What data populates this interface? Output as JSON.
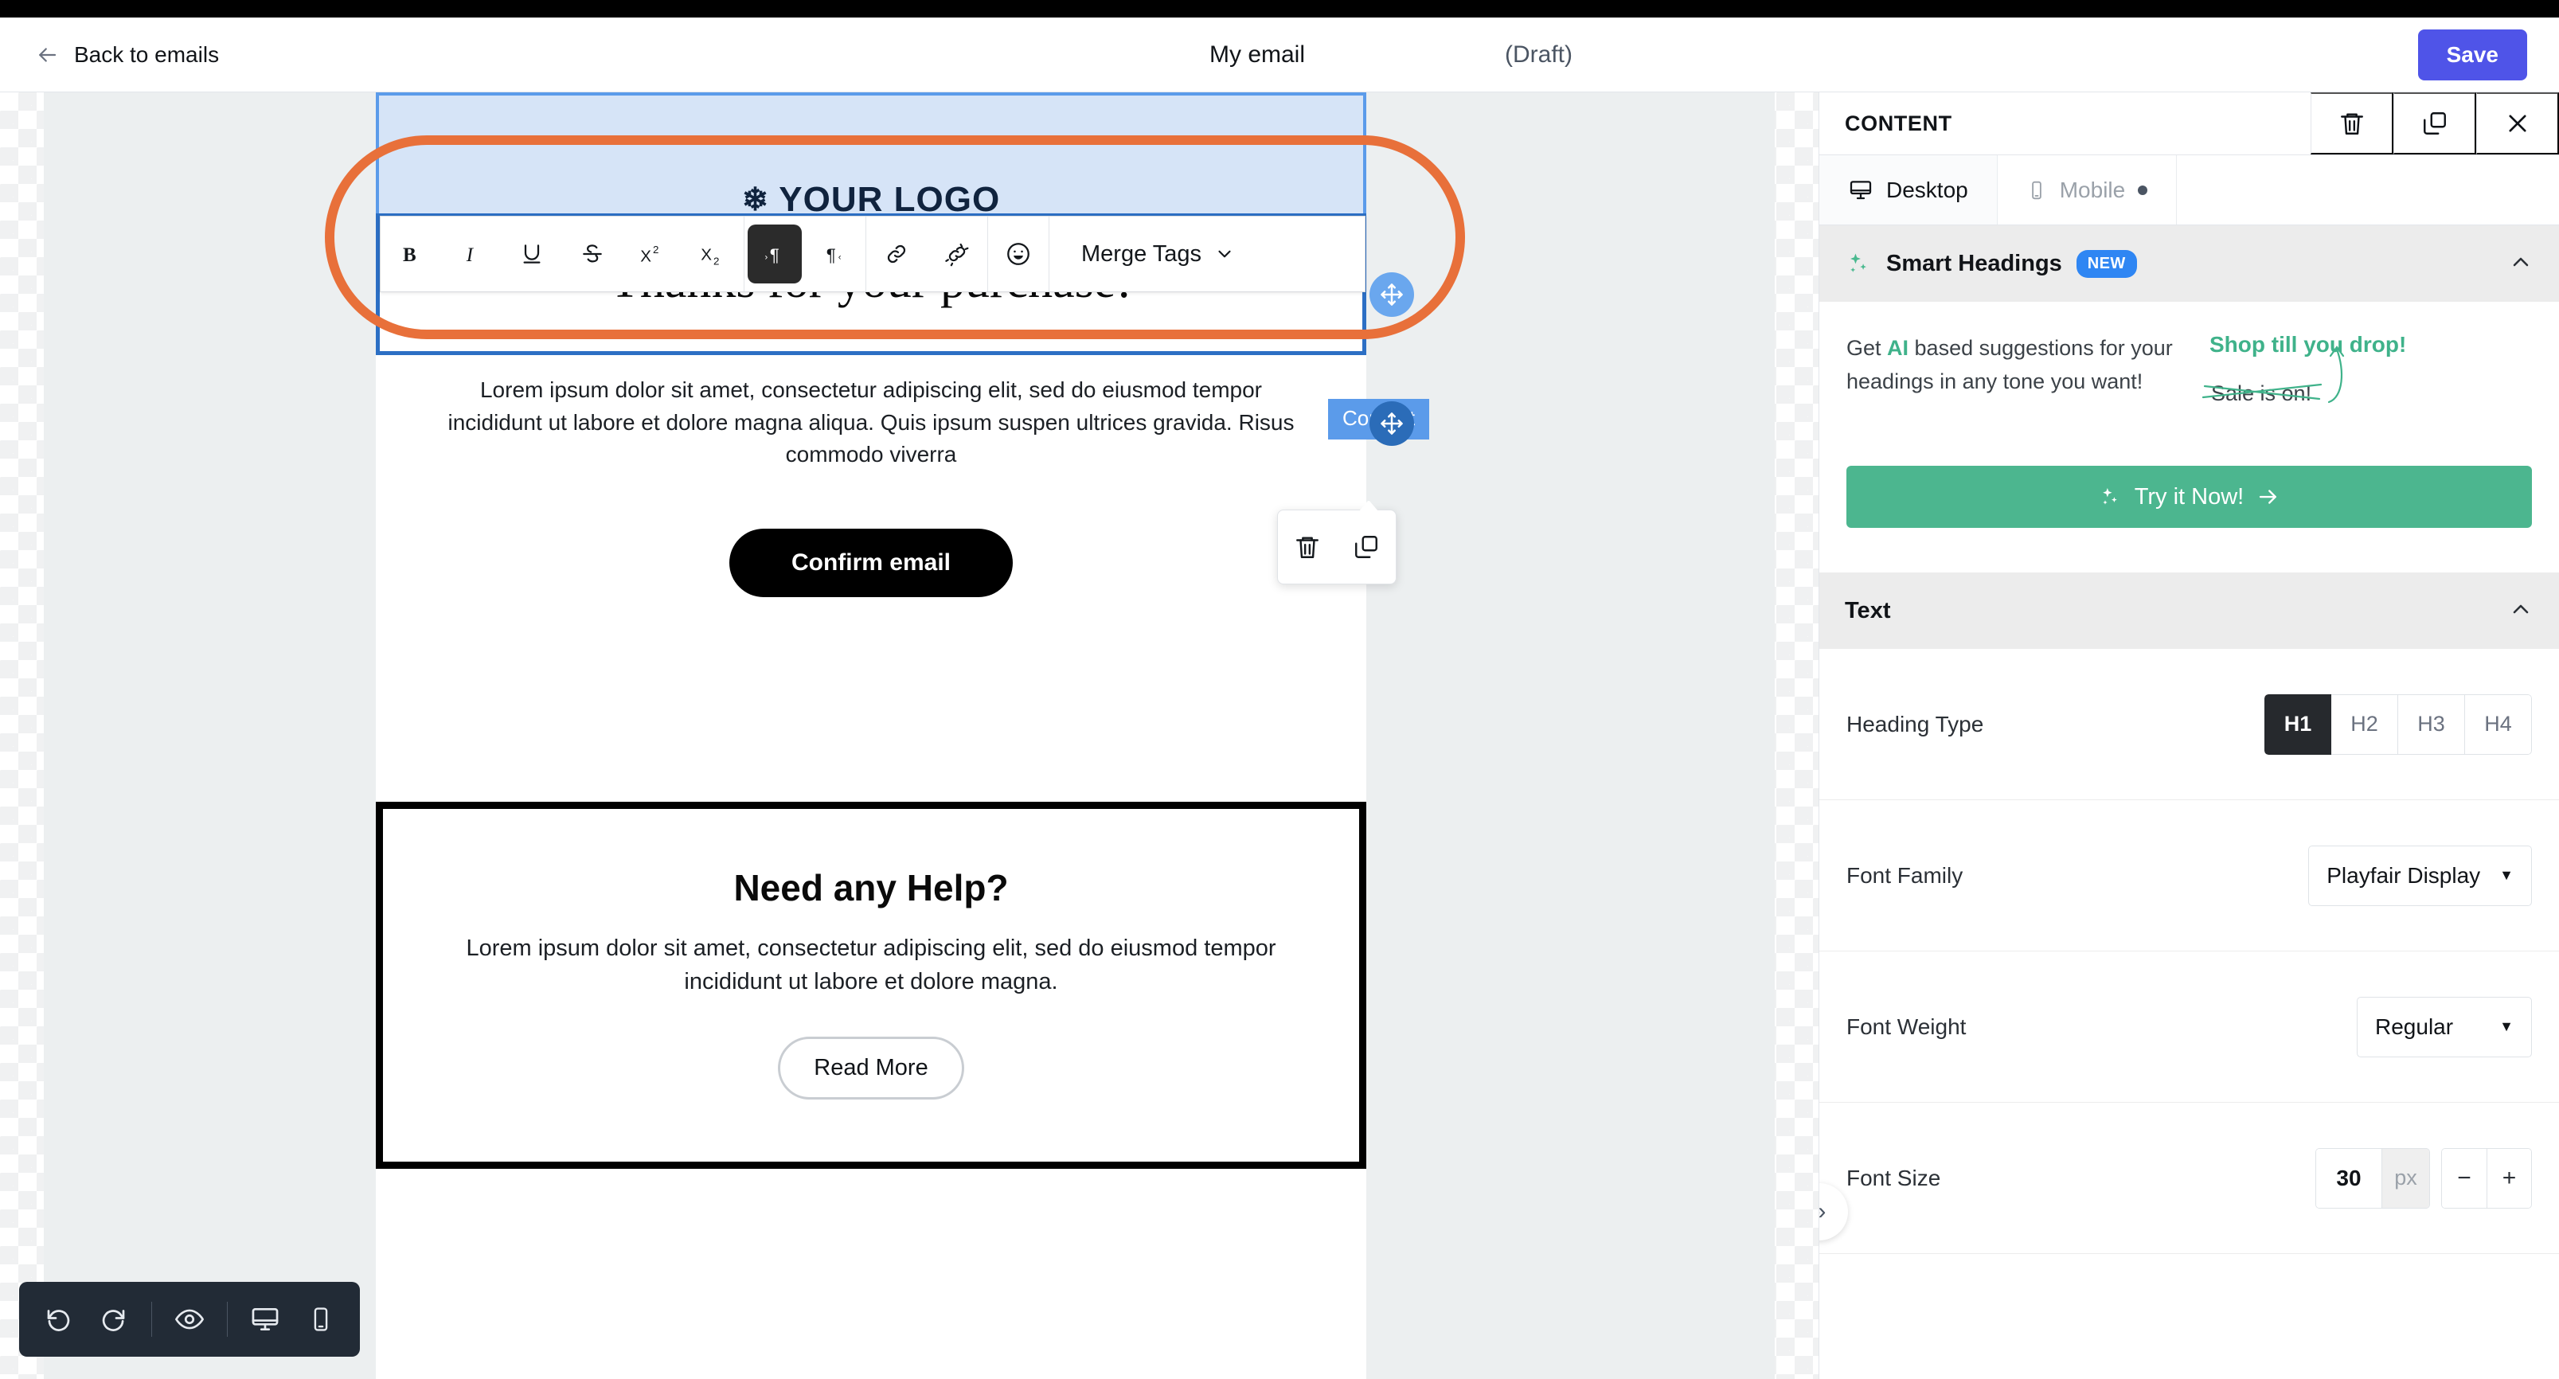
{
  "header": {
    "back_label": "Back to emails",
    "title": "My email",
    "status": "(Draft)",
    "save_label": "Save",
    "accent_color": "#4f54e8"
  },
  "toolbar": {
    "bold": "B",
    "italic": "I",
    "underline": "U",
    "strikethrough": "S",
    "superscript": "X2",
    "subscript": "X2",
    "ltr": "LTR paragraph direction",
    "rtl": "RTL paragraph direction",
    "link": "Insert link",
    "unlink": "Remove link",
    "emoji": "Insert emoji",
    "merge_tags": "Merge Tags"
  },
  "email": {
    "logo_text": "YOUR LOGO",
    "heading": "Thanks for your purchase!",
    "paragraph": "Lorem ipsum dolor sit amet, consectetur adipiscing elit, sed do eiusmod tempor incididunt ut labore et dolore magna aliqua. Quis ipsum suspen ultrices gravida. Risus commodo viverra",
    "cta_label": "Confirm email",
    "help_title": "Need any Help?",
    "help_text": "Lorem ipsum dolor sit amet, consectetur adipiscing elit, sed do eiusmod tempor incididunt ut labore et dolore magna.",
    "read_more_label": "Read More",
    "selection_badge": "Content"
  },
  "bottom_bar": {
    "undo": "undo",
    "redo": "redo",
    "preview": "preview",
    "desktop": "desktop view",
    "mobile": "mobile view"
  },
  "panel": {
    "title": "CONTENT",
    "delete": "delete",
    "duplicate": "duplicate",
    "close": "close",
    "tabs": [
      {
        "label": "Desktop",
        "active": true
      },
      {
        "label": "Mobile",
        "active": false,
        "dot": true
      }
    ],
    "smart_headings": {
      "title": "Smart Headings",
      "badge": "NEW",
      "copy_pre": "Get ",
      "copy_hl": "AI",
      "copy_post": " based suggestions for your headings in any tone you want!",
      "sample_good": "Shop till you drop!",
      "sample_bad": "Sale is on!",
      "cta_label": "Try it Now!",
      "cta_color": "#4cb68f",
      "highlight_color": "#3fb28a"
    },
    "text_section": {
      "title": "Text",
      "heading_type_label": "Heading Type",
      "heading_types": [
        "H1",
        "H2",
        "H3",
        "H4"
      ],
      "heading_type_selected": "H1",
      "font_family_label": "Font Family",
      "font_family_value": "Playfair Display",
      "font_weight_label": "Font Weight",
      "font_weight_value": "Regular",
      "font_size_label": "Font Size",
      "font_size_value": "30",
      "font_size_unit": "px",
      "minus": "−",
      "plus": "+"
    },
    "collapse_label": "»"
  }
}
